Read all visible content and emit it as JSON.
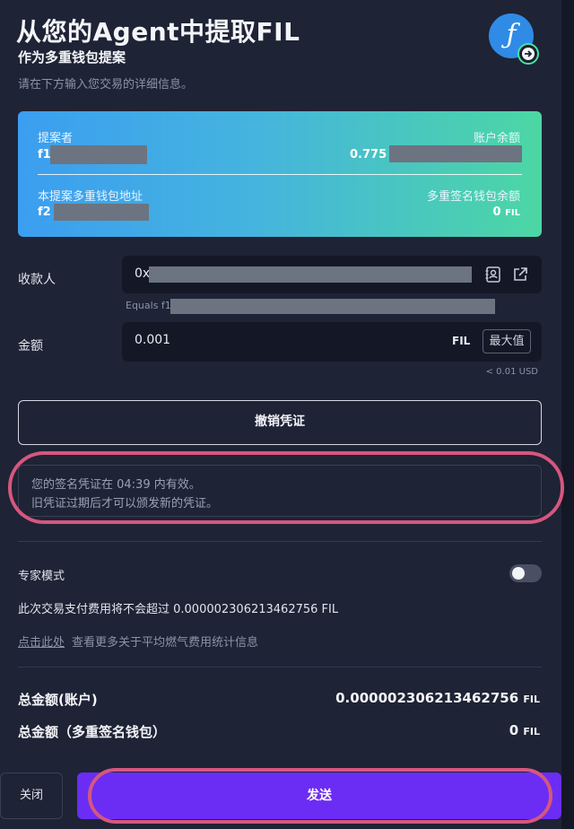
{
  "header": {
    "title": "从您的Agent中提取FIL",
    "subtitle": "作为多重钱包提案",
    "hint": "请在下方输入您交易的详细信息。",
    "avatar_glyph": "ƒ"
  },
  "card": {
    "proposer_label": "提案者",
    "proposer_value": "f1",
    "balance_label": "账户余额",
    "balance_value": "0.775",
    "msig_address_label": "本提案多重钱包地址",
    "msig_address_value": "f2",
    "msig_balance_label": "多重签名钱包余额",
    "msig_balance_value": "0",
    "msig_balance_unit": "FIL"
  },
  "recipient": {
    "label": "收款人",
    "value": "0x",
    "equals": "Equals f1"
  },
  "amount": {
    "label": "金额",
    "value": "0.001",
    "unit": "FIL",
    "max_label": "最大值",
    "usd": "< 0.01 USD"
  },
  "revoke_label": "撤销凭证",
  "notice": {
    "line1": "您的签名凭证在 04:39 内有效。",
    "line2": "旧凭证过期后才可以颁发新的凭证。"
  },
  "expert_mode_label": "专家模式",
  "fee_text": "此次交易支付费用将不会超过 0.000002306213462756 FIL",
  "gas_link": "点击此处",
  "gas_link_rest": "查看更多关于平均燃气费用统计信息",
  "totals": {
    "account_label": "总金额(账户)",
    "account_value": "0.000002306213462756",
    "account_unit": "FIL",
    "msig_label": "总金额（多重签名钱包）",
    "msig_value": "0",
    "msig_unit": "FIL"
  },
  "footer": {
    "close_label": "关闭",
    "send_label": "发送"
  },
  "colors": {
    "background": "#1e2335",
    "accent": "#6b2df3",
    "highlight": "#d5577e",
    "card_gradient_start": "#3b9ef0",
    "card_gradient_end": "#4cd7a4"
  }
}
